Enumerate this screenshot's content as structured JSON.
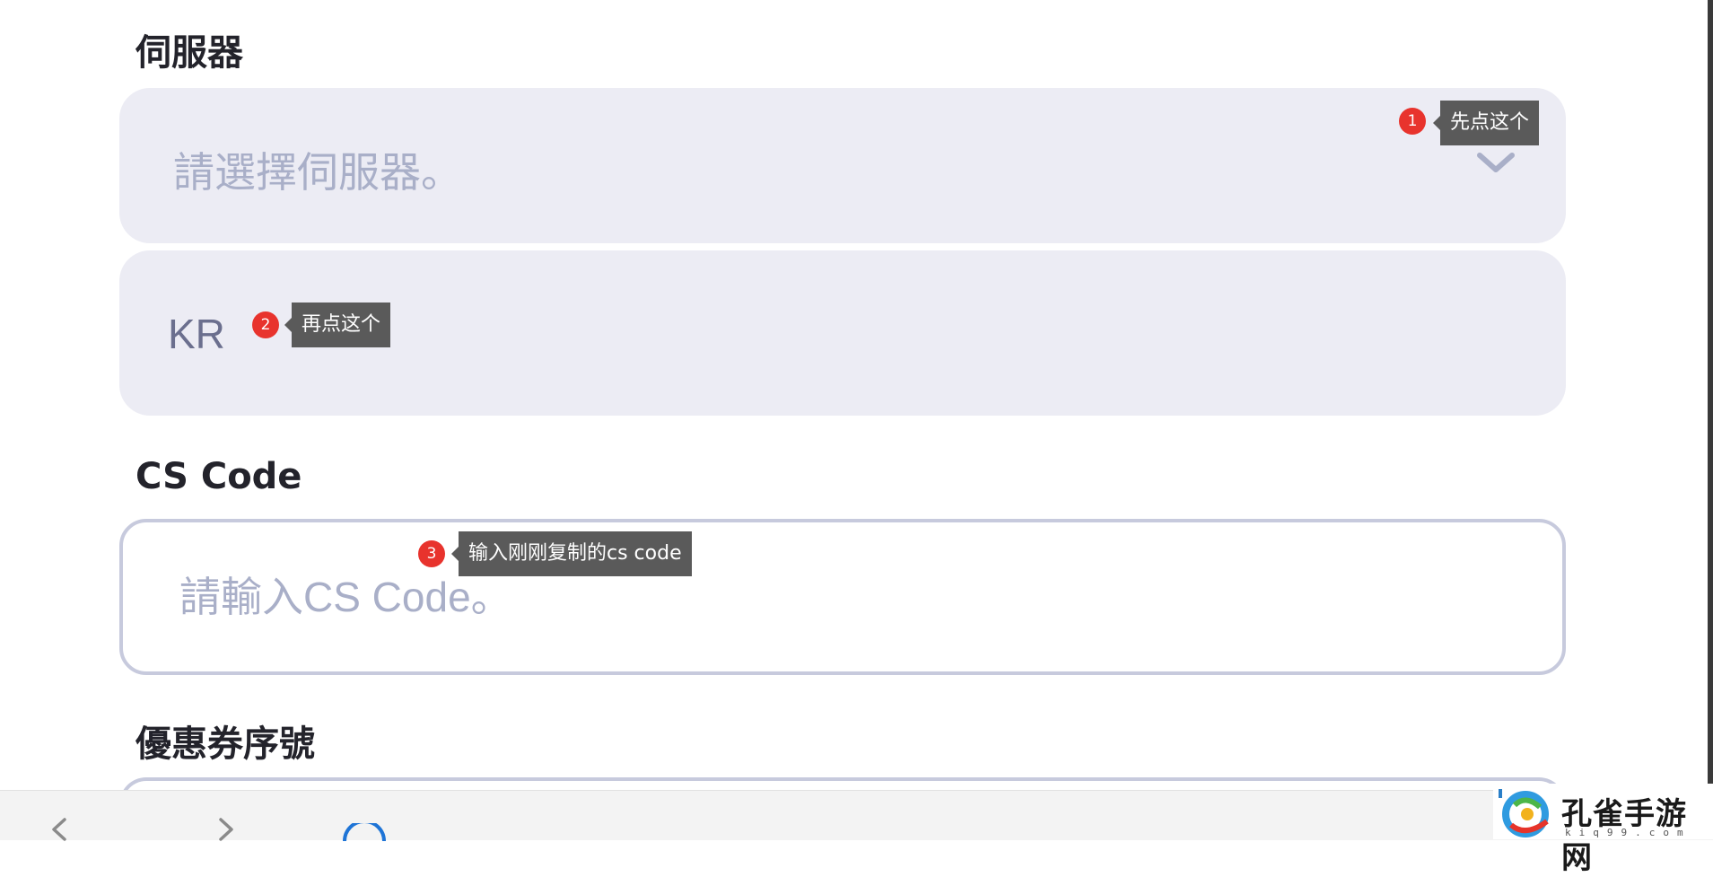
{
  "server_section": {
    "label": "伺服器",
    "placeholder": "請選擇伺服器。",
    "option": "KR"
  },
  "cs_code_section": {
    "label": "CS Code",
    "placeholder": "請輸入CS Code。"
  },
  "coupon_section": {
    "label": "優惠券序號"
  },
  "annotations": [
    {
      "number": "1",
      "text": "先点这个"
    },
    {
      "number": "2",
      "text": "再点这个"
    },
    {
      "number": "3",
      "text": "输入刚刚复制的cs code"
    }
  ],
  "logo": {
    "text": "孔雀手游网",
    "sub": "kiq99.com"
  },
  "colors": {
    "field_bg": "#ececf4",
    "placeholder": "#a9afc8",
    "annotation_badge": "#e8332d",
    "annotation_tip": "#5a5a5a"
  }
}
